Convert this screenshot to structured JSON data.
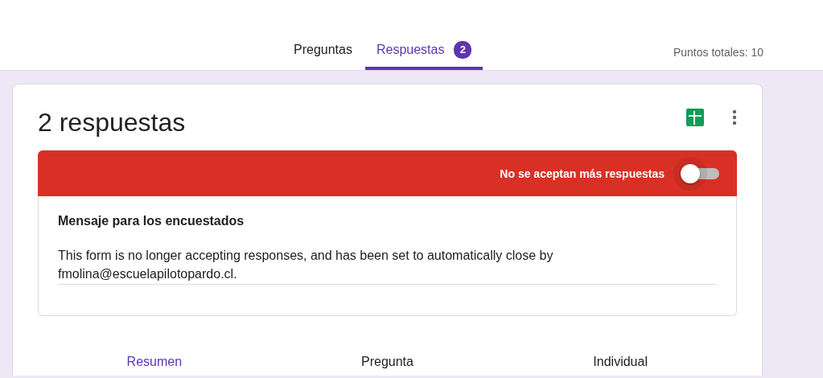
{
  "tabs": [
    {
      "label": "Preguntas",
      "selected": false
    },
    {
      "label": "Respuestas",
      "selected": true,
      "badge": "2"
    }
  ],
  "total_points": "Puntos totales: 10",
  "title": "2 respuestas",
  "banner": {
    "label": "No se aceptan más respuestas",
    "on": false
  },
  "message": {
    "heading": "Mensaje para los encuestados",
    "value": "This form is no longer accepting responses, and has been set to automatically close by fmolina@escuelapilotopardo.cl."
  },
  "views": [
    {
      "label": "Resumen",
      "selected": true
    },
    {
      "label": "Pregunta",
      "selected": false
    },
    {
      "label": "Individual",
      "selected": false
    }
  ]
}
